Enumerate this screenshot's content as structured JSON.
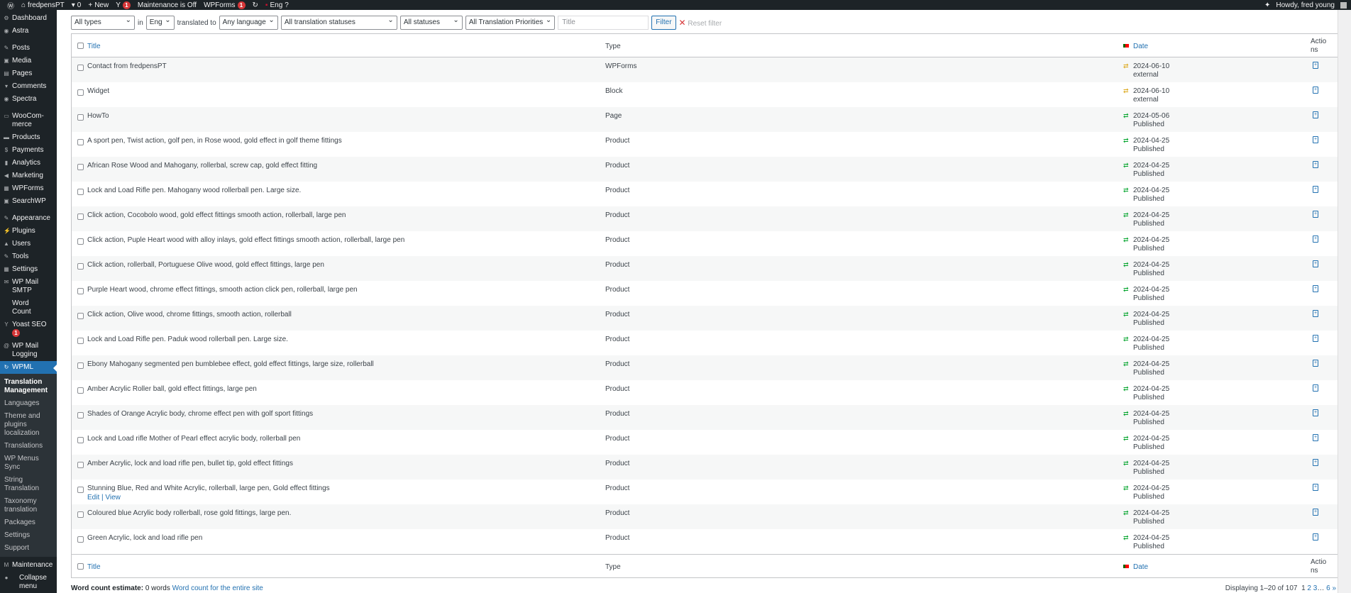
{
  "adminbar": {
    "site": "fredpensPT",
    "comments": "0",
    "new": "New",
    "yoast_badge": "1",
    "maintenance": "Maintenance is Off",
    "wpforms": "WPForms",
    "wpforms_badge": "1",
    "lang": "Eng",
    "howdy": "Howdy, fred young"
  },
  "sidebar": {
    "items": [
      {
        "label": "Dashboard",
        "icon": "dashboard-icon",
        "g": "⚙"
      },
      {
        "label": "Astra",
        "icon": "astra-icon",
        "g": "◉"
      },
      {
        "sep": true
      },
      {
        "label": "Posts",
        "icon": "pin-icon",
        "g": "✎"
      },
      {
        "label": "Media",
        "icon": "media-icon",
        "g": "▣"
      },
      {
        "label": "Pages",
        "icon": "pages-icon",
        "g": "▤"
      },
      {
        "label": "Comments",
        "icon": "comments-icon",
        "g": "▾"
      },
      {
        "label": "Spectra",
        "icon": "spectra-icon",
        "g": "◉"
      },
      {
        "sep": true
      },
      {
        "label": "WooCom- merce",
        "icon": "woocommerce-icon",
        "g": "▭"
      },
      {
        "label": "Products",
        "icon": "products-icon",
        "g": "▬"
      },
      {
        "label": "Payments",
        "icon": "payments-icon",
        "g": "$"
      },
      {
        "label": "Analytics",
        "icon": "analytics-icon",
        "g": "▮"
      },
      {
        "label": "Marketing",
        "icon": "marketing-icon",
        "g": "◀"
      },
      {
        "label": "WPForms",
        "icon": "wpforms-icon",
        "g": "▦"
      },
      {
        "label": "SearchWP",
        "icon": "searchwp-icon",
        "g": "▣"
      },
      {
        "sep": true
      },
      {
        "label": "Appearance",
        "icon": "appearance-icon",
        "g": "✎"
      },
      {
        "label": "Plugins",
        "icon": "plugins-icon",
        "g": "⚡"
      },
      {
        "label": "Users",
        "icon": "users-icon",
        "g": "▲"
      },
      {
        "label": "Tools",
        "icon": "tools-icon",
        "g": "✎"
      },
      {
        "label": "Settings",
        "icon": "settings-icon",
        "g": "▦"
      },
      {
        "label": "WP Mail SMTP",
        "icon": "mail-icon",
        "g": "✉"
      },
      {
        "label": "Word Count",
        "icon": "",
        "g": ""
      },
      {
        "label": "Yoast SEO",
        "icon": "yoast-icon",
        "g": "Y",
        "badge": "1"
      },
      {
        "label": "WP Mail Logging",
        "icon": "at-icon",
        "g": "@"
      }
    ],
    "active": "WPML",
    "sub": [
      "Translation Management",
      "Languages",
      "Theme and plugins localization",
      "Translations",
      "WP Menus Sync",
      "String Translation",
      "Taxonomy translation",
      "Packages",
      "Settings",
      "Support"
    ],
    "after": [
      {
        "label": "Maintenance",
        "g": "M"
      },
      {
        "label": "Collapse menu",
        "g": "●"
      }
    ]
  },
  "filters": {
    "type": "All types",
    "in": "in",
    "lang": "Eng",
    "translated_to": "translated to",
    "to_lang": "Any language",
    "tstatus": "All translation statuses",
    "status": "All statuses",
    "priority": "All Translation Priorities",
    "title_placeholder": "Title",
    "filter": "Filter",
    "reset": "Reset filter"
  },
  "table": {
    "headers": {
      "title": "Title",
      "type": "Type",
      "date": "Date",
      "actions": "Actions"
    },
    "rows": [
      {
        "title": "Contact from fredpensPT",
        "type": "WPForms",
        "date": "2024-06-10",
        "status": "external"
      },
      {
        "title": "Widget",
        "type": "Block",
        "date": "2024-06-10",
        "status": "external"
      },
      {
        "title": "HowTo",
        "type": "Page",
        "date": "2024-05-06",
        "status": "Published"
      },
      {
        "title": "A sport pen, Twist action, golf pen, in Rose wood, gold effect in golf theme fittings",
        "type": "Product",
        "date": "2024-04-25",
        "status": "Published"
      },
      {
        "title": "African Rose Wood and Mahogany, rollerbal, screw cap, gold effect fitting",
        "type": "Product",
        "date": "2024-04-25",
        "status": "Published"
      },
      {
        "title": "Lock and Load Rifle pen. Mahogany wood rollerball pen. Large size.",
        "type": "Product",
        "date": "2024-04-25",
        "status": "Published"
      },
      {
        "title": "Click action, Cocobolo wood, gold effect fittings smooth action, rollerball, large pen",
        "type": "Product",
        "date": "2024-04-25",
        "status": "Published"
      },
      {
        "title": "Click action, Puple Heart wood with alloy inlays, gold effect fittings smooth action, rollerball, large pen",
        "type": "Product",
        "date": "2024-04-25",
        "status": "Published"
      },
      {
        "title": "Click action, rollerball, Portuguese Olive wood, gold effect fittings, large pen",
        "type": "Product",
        "date": "2024-04-25",
        "status": "Published"
      },
      {
        "title": "Purple Heart wood, chrome effect fittings, smooth action click pen, rollerball, large pen",
        "type": "Product",
        "date": "2024-04-25",
        "status": "Published"
      },
      {
        "title": "Click action, Olive wood, chrome fittings, smooth action, rollerball",
        "type": "Product",
        "date": "2024-04-25",
        "status": "Published"
      },
      {
        "title": "Lock and Load Rifle pen. Paduk wood rollerball pen. Large size.",
        "type": "Product",
        "date": "2024-04-25",
        "status": "Published"
      },
      {
        "title": "Ebony Mahogany segmented pen bumblebee effect, gold effect fittings, large size, rollerball",
        "type": "Product",
        "date": "2024-04-25",
        "status": "Published"
      },
      {
        "title": "Amber Acrylic Roller ball, gold effect fittings, large pen",
        "type": "Product",
        "date": "2024-04-25",
        "status": "Published"
      },
      {
        "title": "Shades of Orange Acrylic body, chrome effect pen with golf sport fittings",
        "type": "Product",
        "date": "2024-04-25",
        "status": "Published"
      },
      {
        "title": "Lock and Load rifle Mother of Pearl effect acrylic body, rollerball pen",
        "type": "Product",
        "date": "2024-04-25",
        "status": "Published"
      },
      {
        "title": "Amber Acrylic, lock and load rifle pen, bullet tip, gold effect fittings",
        "type": "Product",
        "date": "2024-04-25",
        "status": "Published"
      },
      {
        "title": "Stunning Blue, Red and White Acrylic, rollerball, large pen, Gold effect fittings",
        "type": "Product",
        "date": "2024-04-25",
        "status": "Published",
        "actions": "Edit | View"
      },
      {
        "title": "Coloured blue Acrylic body rollerball, rose gold fittings, large pen.",
        "type": "Product",
        "date": "2024-04-25",
        "status": "Published"
      },
      {
        "title": "Green Acrylic, lock and load rifle pen",
        "type": "Product",
        "date": "2024-04-25",
        "status": "Published"
      }
    ]
  },
  "colors": {
    "external": "#dba617",
    "published": "#00a32a"
  },
  "footer": {
    "wc_label": "Word count estimate:",
    "wc_value": "0 words",
    "wc_link": "Word count for the entire site",
    "displaying": "Displaying 1–20 of 107",
    "pages": [
      "1",
      "2",
      "3",
      "…",
      "6",
      "»"
    ]
  }
}
